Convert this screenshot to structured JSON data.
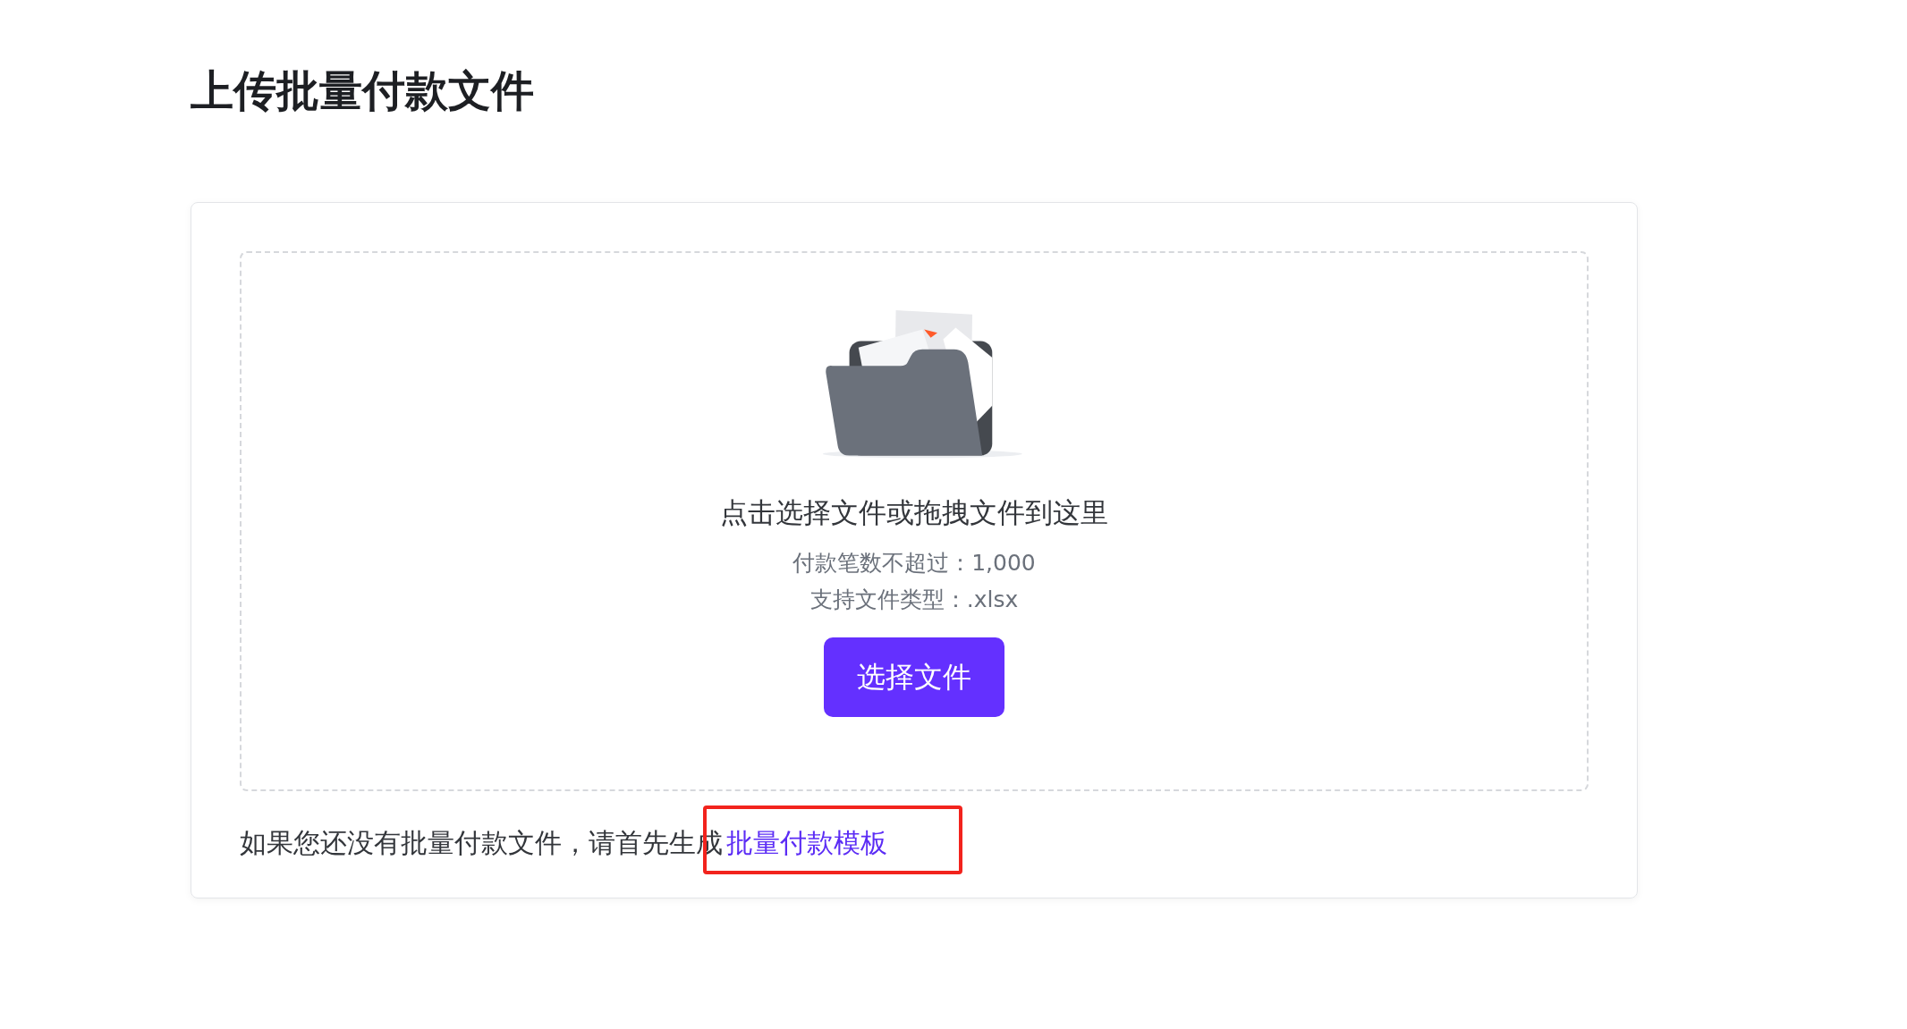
{
  "page": {
    "title": "上传批量付款文件"
  },
  "upload": {
    "prompt": "点击选择文件或拖拽文件到这里",
    "limits": [
      "付款笔数不超过：1,000",
      "支持文件类型：.xlsx"
    ],
    "button": "选择文件"
  },
  "footer": {
    "text": "如果您还没有批量付款文件，请首先生成",
    "link": {
      "text": "批量付款模板",
      "highlighted": true
    }
  }
}
